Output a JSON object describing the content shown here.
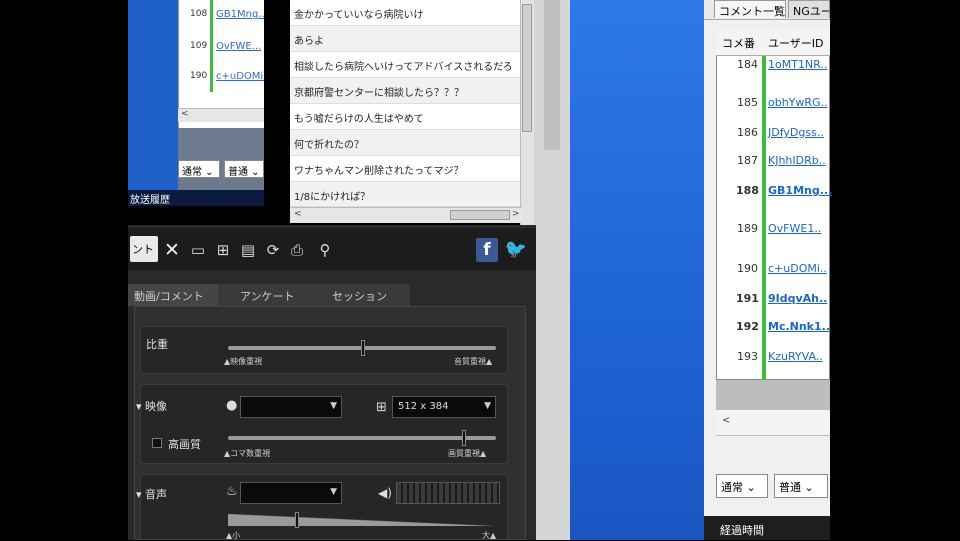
{
  "top_left_window": {
    "rows": [
      {
        "num": "108",
        "uid": "GB1Mng..."
      },
      {
        "num": "109",
        "uid": "OvFWE..."
      },
      {
        "num": "190",
        "uid": "c+uDOMi..."
      }
    ],
    "scroll_left": "<",
    "select_mode": "通常",
    "select_size": "普通",
    "status_text": "放送履歴"
  },
  "comments": [
    "金かかっていいなら病院いけ",
    "あらよ",
    "相談したら病院へいけってアドバイスされるだろ",
    "京都府警センターに相談したら？？？",
    "もう嘘だらけの人生はやめて",
    "何で折れたの？",
    "ワナちゃんマン削除されたってマジ？",
    "1/8にかければ？"
  ],
  "comment_scroll": {
    "left": "<",
    "right": ">"
  },
  "control_panel": {
    "first_tab": "ント",
    "icons": [
      "close-icon",
      "comment-icon",
      "screen-icon",
      "keyboard-icon",
      "refresh-icon",
      "print-icon",
      "search-icon"
    ],
    "tabs": [
      "動画/コメント",
      "アンケート",
      "セッション"
    ],
    "sections": {
      "ratio": {
        "label": "比重",
        "left_label": "映像重視",
        "right_label": "音質重視",
        "value": 0.5
      },
      "video": {
        "label": "映像",
        "device": "",
        "resolution": "512 x 384",
        "hq_label": "高画質",
        "left_label": "コマ数重視",
        "right_label": "画質重視",
        "value": 0.88
      },
      "audio": {
        "label": "音声",
        "device": "",
        "left_label": "小",
        "right_label": "大",
        "value": 0.25
      }
    }
  },
  "right_window": {
    "tabs": [
      "コメント一覧",
      "NGユーザー"
    ],
    "columns": [
      "コメ番",
      "ユーザーID"
    ],
    "rows": [
      {
        "num": "184",
        "uid": "1oMT1NR..",
        "bold": false
      },
      {
        "num": "185",
        "uid": "obhYwRG..",
        "bold": false
      },
      {
        "num": "186",
        "uid": "JDfyDgss..",
        "bold": false
      },
      {
        "num": "187",
        "uid": "KJhhIDRb..",
        "bold": false
      },
      {
        "num": "188",
        "uid": "GB1Mng...",
        "bold": true
      },
      {
        "num": "189",
        "uid": "OvFWE1..",
        "bold": false
      },
      {
        "num": "190",
        "uid": "c+uDOMi..",
        "bold": false
      },
      {
        "num": "191",
        "uid": "9IdqvAh..",
        "bold": true
      },
      {
        "num": "192",
        "uid": "Mc.Nnk1..",
        "bold": true
      },
      {
        "num": "193",
        "uid": "KzuRYVA..",
        "bold": false
      }
    ],
    "scroll_left": "<",
    "select_mode": "通常",
    "select_size": "普通",
    "bottom_text": "経過時間"
  },
  "colors": {
    "desktop_blue": "#1e63d6",
    "link_blue": "#1a66d0",
    "accent_green": "#3bbf3b",
    "facebook_blue": "#3b5998",
    "twitter_blue": "#39b3e8"
  }
}
